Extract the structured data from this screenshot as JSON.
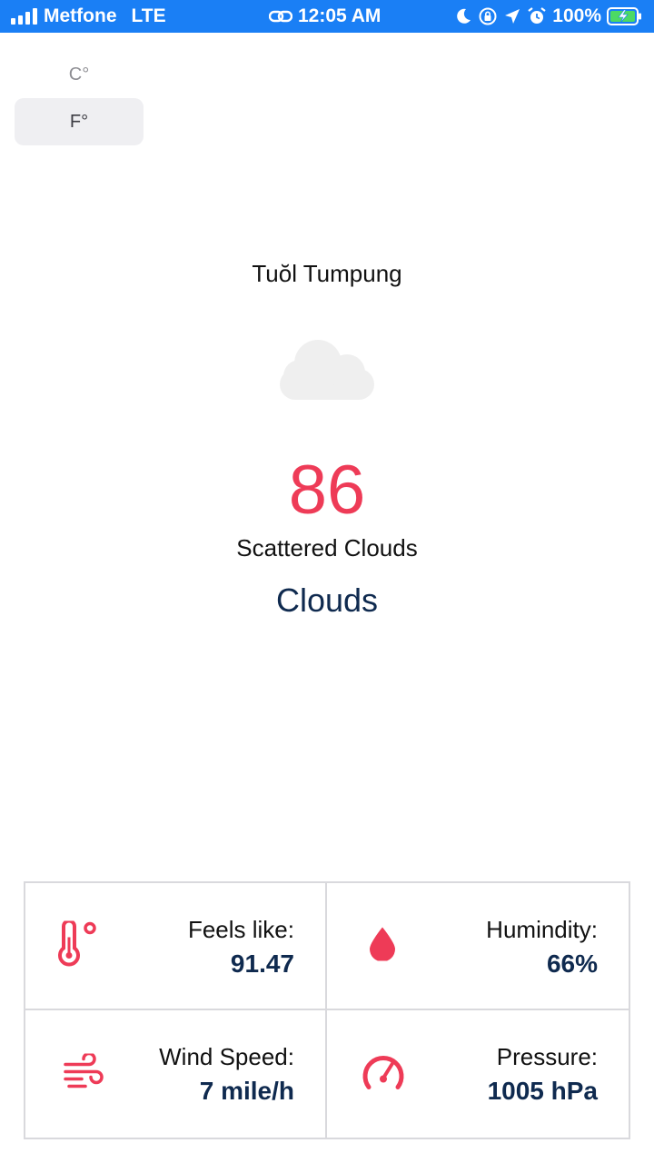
{
  "status_bar": {
    "carrier": "Metfone",
    "network": "LTE",
    "time": "12:05 AM",
    "battery": "100%"
  },
  "unit_toggle": {
    "celsius_label": "C°",
    "fahrenheit_label": "F°",
    "selected": "F°"
  },
  "weather": {
    "city": "Tuŏl Tumpung",
    "icon": "cloud-icon",
    "temperature": "86",
    "description": "Scattered Clouds",
    "main": "Clouds"
  },
  "details": {
    "feels_like": {
      "label": "Feels like:",
      "value": "91.47",
      "icon": "thermometer-icon"
    },
    "humidity": {
      "label": "Humindity:",
      "value": "66%",
      "icon": "drop-icon"
    },
    "wind_speed": {
      "label": "Wind Speed:",
      "value": "7 mile/h",
      "icon": "wind-icon"
    },
    "pressure": {
      "label": "Pressure:",
      "value": "1005 hPa",
      "icon": "gauge-icon"
    }
  },
  "colors": {
    "status_bar": "#1a7ff5",
    "accent_red": "#ee3b57",
    "navy": "#0f2a4f"
  }
}
